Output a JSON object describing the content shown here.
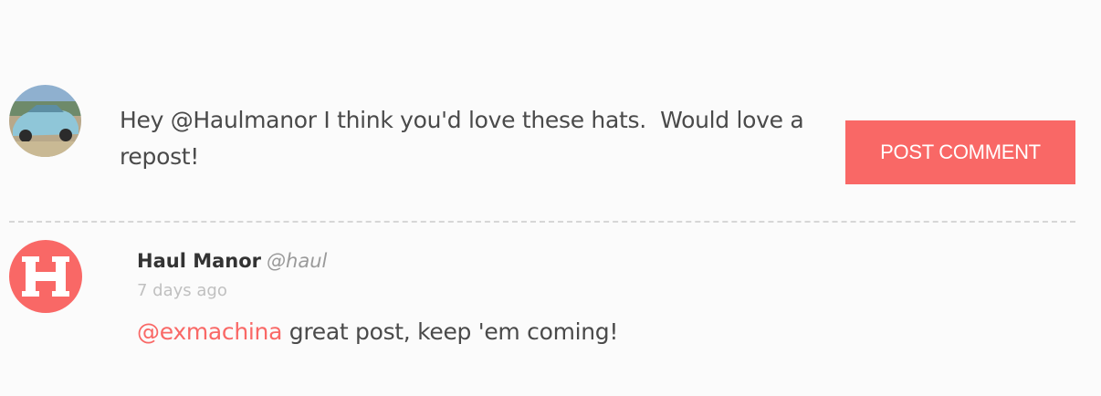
{
  "composer": {
    "draft_text": "Hey @Haulmanor I think you'd love these hats.  Would love a repost!",
    "post_button_label": "POST COMMENT"
  },
  "comment": {
    "author_name": "Haul Manor",
    "author_handle": "@haul",
    "time_ago": "7 days ago",
    "mention": "@exmachina",
    "body": " great post, keep 'em coming!",
    "avatar_letter": "H",
    "avatar_icon": "haul-manor-logo-icon"
  },
  "colors": {
    "accent": "#f96866",
    "text": "#4a4a4a",
    "muted": "#c0c0c0",
    "divider": "#d6d6d6"
  }
}
